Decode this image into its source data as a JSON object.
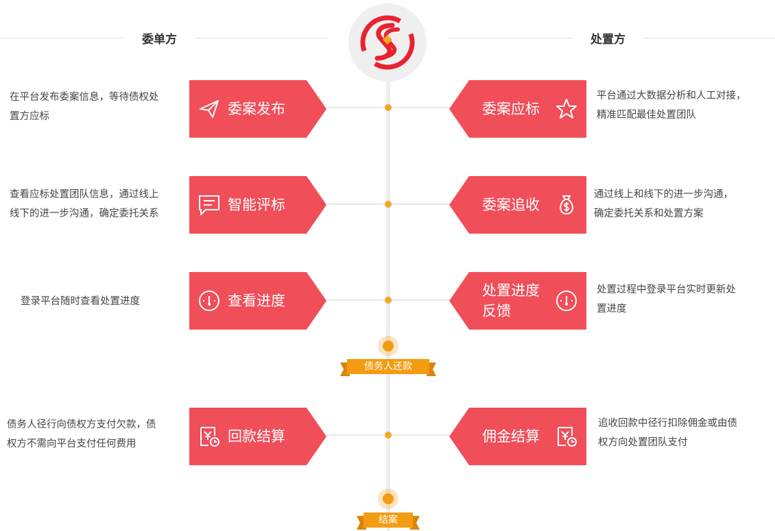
{
  "header": {
    "left_title": "委单方",
    "right_title": "处置方"
  },
  "colors": {
    "step": "#f04e59",
    "accent": "#f39c12",
    "logo": "#e8232f"
  },
  "left_steps": [
    {
      "label": "委案发布",
      "icon": "paper-plane-icon",
      "desc": [
        "在平台发布委案信息，等待债权处",
        "置方应标"
      ]
    },
    {
      "label": "智能评标",
      "icon": "message-icon",
      "desc": [
        "查看应标处置团队信息，通过线上",
        "线下的进一步沟通，确定委托关系"
      ]
    },
    {
      "label": "查看进度",
      "icon": "gauge-icon",
      "desc": [
        "登录平台随时查看处置进度"
      ]
    },
    {
      "label": "回款结算",
      "icon": "bill-icon",
      "desc": [
        "债务人径行向债权方支付欠款，债",
        "权方不需向平台支付任何费用"
      ]
    }
  ],
  "right_steps": [
    {
      "label": "委案应标",
      "icon": "star-icon",
      "desc": [
        "平台通过大数据分析和人工对接，",
        "精准匹配最佳处置团队"
      ]
    },
    {
      "label": "委案追收",
      "icon": "money-bag-icon",
      "desc": [
        "通过线上和线下的进一步沟通，",
        "确定委托关系和处置方案"
      ]
    },
    {
      "label_lines": [
        "处置进度",
        "反馈"
      ],
      "icon": "gauge-icon",
      "desc": [
        "处置过程中登录平台实时更新处",
        "置进度"
      ]
    },
    {
      "label": "佣金结算",
      "icon": "bill-icon",
      "desc": [
        "追收回款中径行扣除佣金或由债",
        "权方向处置团队支付"
      ]
    }
  ],
  "milestones": [
    {
      "label": "债务人还款"
    },
    {
      "label": "结案"
    }
  ]
}
